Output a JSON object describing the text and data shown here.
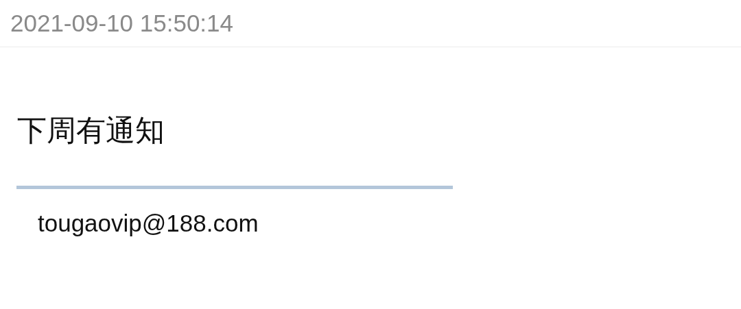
{
  "header": {
    "timestamp": "2021-09-10 15:50:14"
  },
  "message": {
    "body": "下周有通知"
  },
  "signature": {
    "email": "tougaovip@188.com"
  }
}
